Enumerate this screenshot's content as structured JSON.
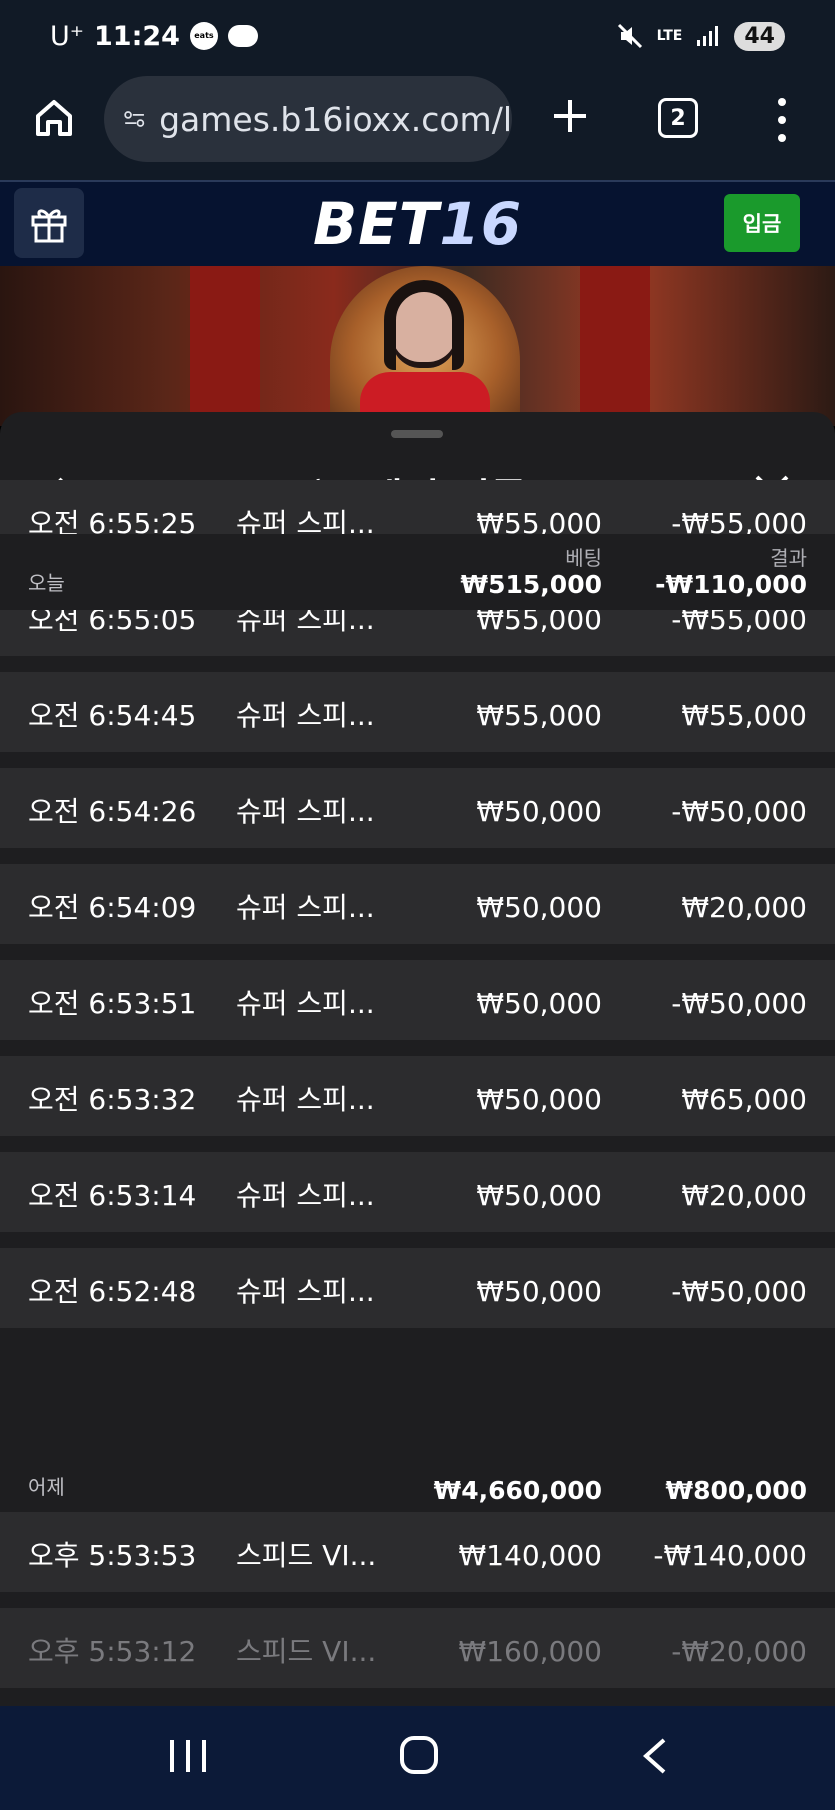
{
  "status_bar": {
    "carrier": "U⁺",
    "time": "11:24",
    "app_badge": "eats",
    "network": "LTE",
    "battery": "44"
  },
  "browser": {
    "url": "games.b16ioxx.com/l",
    "tab_count": "2"
  },
  "site": {
    "logo_part1": "BET",
    "logo_part2": "16",
    "deposit_label": "입금"
  },
  "panel": {
    "title": "게임 기록",
    "col_bet_label": "베팅",
    "col_result_label": "결과",
    "today": {
      "label": "오늘",
      "bet_total": "₩515,000",
      "result_total": "-₩110,000",
      "rows": [
        {
          "time": "오전 6:55:25",
          "game": "슈퍼 스피...",
          "bet": "₩55,000",
          "result": "-₩55,000"
        },
        {
          "time": "오전 6:55:05",
          "game": "슈퍼 스피...",
          "bet": "₩55,000",
          "result": "-₩55,000"
        },
        {
          "time": "오전 6:54:45",
          "game": "슈퍼 스피...",
          "bet": "₩55,000",
          "result": "₩55,000"
        },
        {
          "time": "오전 6:54:26",
          "game": "슈퍼 스피...",
          "bet": "₩50,000",
          "result": "-₩50,000"
        },
        {
          "time": "오전 6:54:09",
          "game": "슈퍼 스피...",
          "bet": "₩50,000",
          "result": "₩20,000"
        },
        {
          "time": "오전 6:53:51",
          "game": "슈퍼 스피...",
          "bet": "₩50,000",
          "result": "-₩50,000"
        },
        {
          "time": "오전 6:53:32",
          "game": "슈퍼 스피...",
          "bet": "₩50,000",
          "result": "₩65,000"
        },
        {
          "time": "오전 6:53:14",
          "game": "슈퍼 스피...",
          "bet": "₩50,000",
          "result": "₩20,000"
        },
        {
          "time": "오전 6:52:48",
          "game": "슈퍼 스피...",
          "bet": "₩50,000",
          "result": "-₩50,000"
        }
      ]
    },
    "yesterday": {
      "label": "어제",
      "bet_total": "₩4,660,000",
      "result_total": "₩800,000",
      "rows": [
        {
          "time": "오후 5:53:53",
          "game": "스피드 VI...",
          "bet": "₩140,000",
          "result": "-₩140,000"
        },
        {
          "time": "오후 5:53:12",
          "game": "스피드 VI...",
          "bet": "₩160,000",
          "result": "-₩20,000"
        }
      ]
    }
  }
}
